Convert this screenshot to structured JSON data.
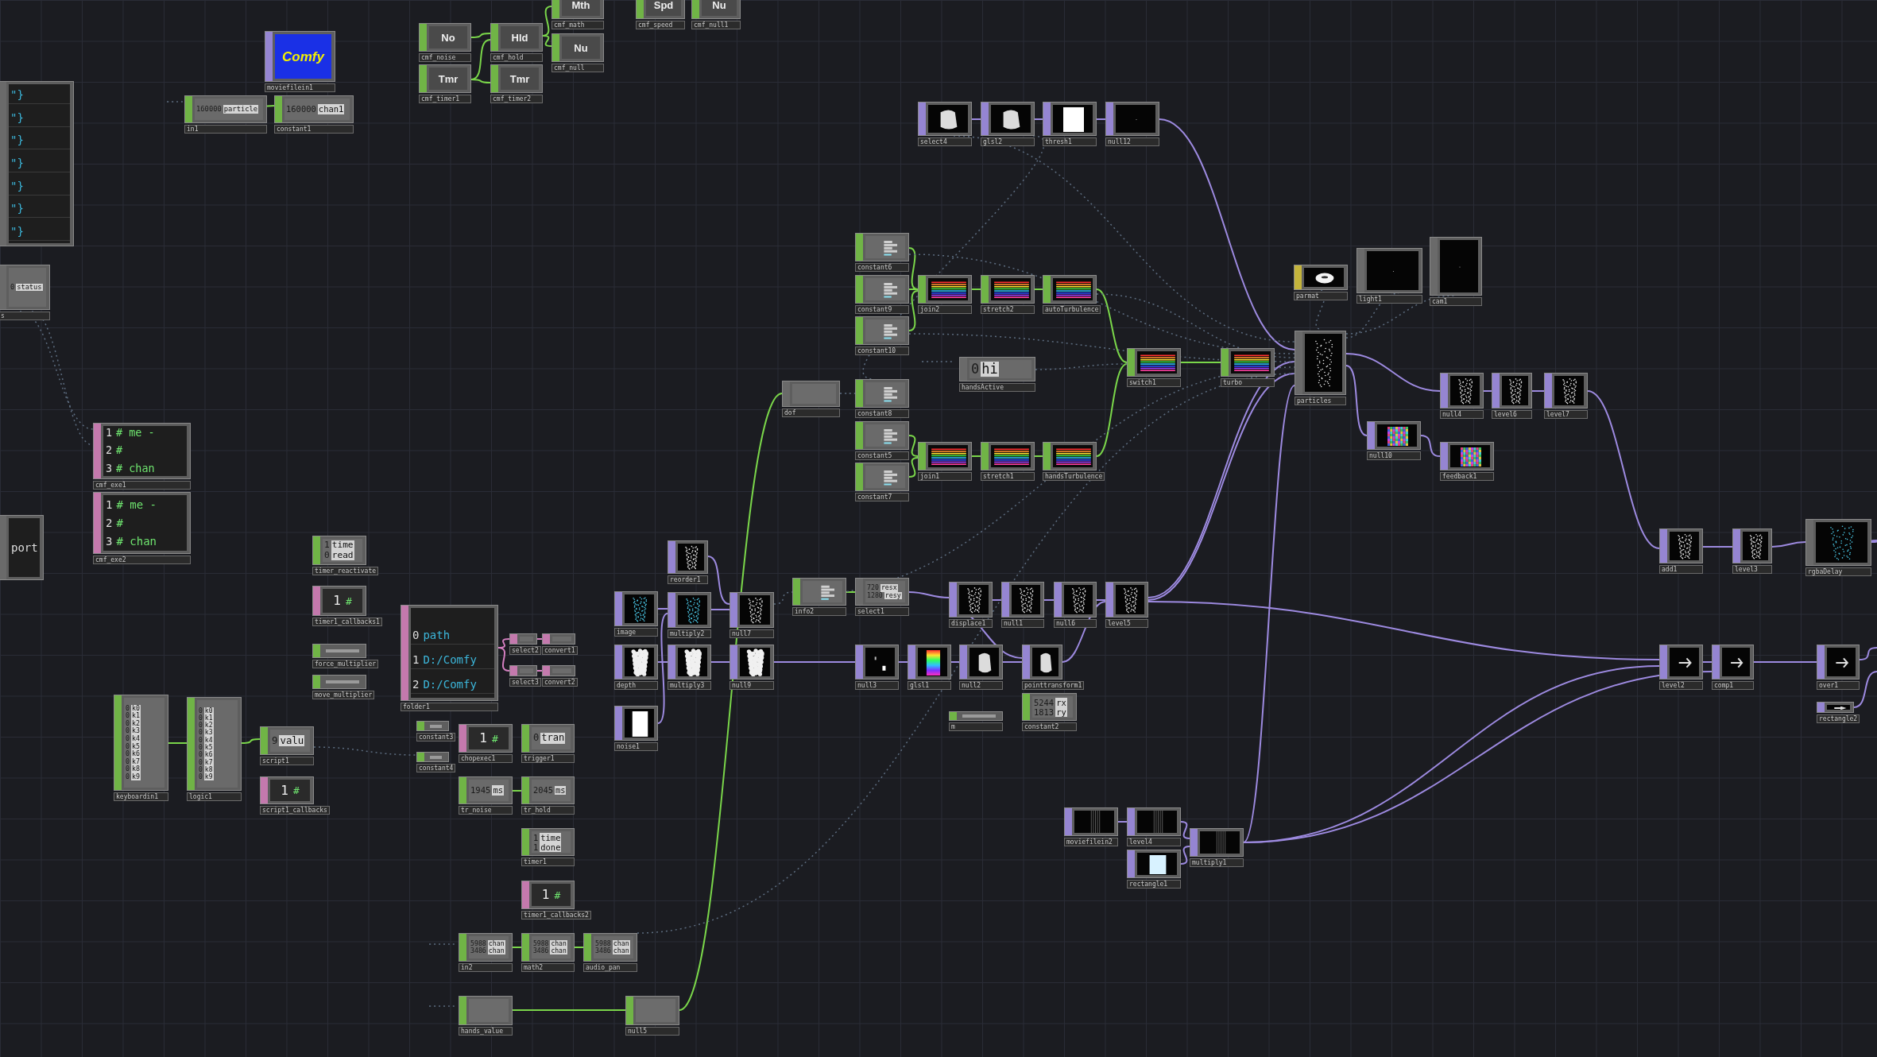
{
  "nodes": [
    {
      "color": "#6a6a6a",
      "kind": "table",
      "rows": [
        [
          "\"}"
        ],
        [
          "\"}"
        ],
        [
          "\"}"
        ],
        [
          "\"}"
        ],
        [
          "\"}"
        ],
        [
          "\"}"
        ],
        [
          "\"}"
        ]
      ]
    },
    {
      "color": "#6a6a6a",
      "label": "s",
      "kind": "rows",
      "rows": [
        [
          "0",
          "status"
        ]
      ]
    },
    {
      "color": "#9585d2",
      "label": "moviefilein1",
      "kind": "logo",
      "text": "Comfy"
    },
    {
      "color": "#70b446",
      "label": "in1",
      "kind": "rows",
      "rows": [
        [
          "160000",
          "particle"
        ]
      ]
    },
    {
      "color": "#70b446",
      "label": "constant1",
      "kind": "rows",
      "rows": [
        [
          "160000",
          "chan1"
        ]
      ]
    },
    {
      "color": "#70b446",
      "label": "cmf_noise",
      "kind": "icon",
      "text": "No"
    },
    {
      "color": "#70b446",
      "label": "cmf_hold",
      "kind": "icon",
      "text": "Hld"
    },
    {
      "color": "#70b446",
      "label": "cmf_timer1",
      "kind": "icon",
      "text": "Tmr"
    },
    {
      "color": "#70b446",
      "label": "cmf_timer2",
      "kind": "icon",
      "text": "Tmr"
    },
    {
      "color": "#70b446",
      "label": "cmf_math",
      "kind": "icon",
      "text": "Mth"
    },
    {
      "color": "#70b446",
      "label": "cmf_null",
      "kind": "icon",
      "text": "Nu"
    },
    {
      "color": "#70b446",
      "label": "cmf_speed",
      "kind": "icon",
      "text": "Spd"
    },
    {
      "color": "#70b446",
      "label": "cmf_null1",
      "kind": "icon",
      "text": "Nu"
    },
    {
      "color": "#c479ad",
      "label": "cmf_exe1",
      "kind": "code",
      "lines": [
        {
          "n": "1",
          "text": "# me -"
        },
        {
          "n": "2",
          "text": "#"
        },
        {
          "n": "3",
          "text": "# chan"
        }
      ]
    },
    {
      "color": "#c479ad",
      "label": "cmf_exe2",
      "kind": "code",
      "lines": [
        {
          "n": "1",
          "text": "# me -"
        },
        {
          "n": "2",
          "text": "#"
        },
        {
          "n": "3",
          "text": "# chan"
        }
      ]
    },
    {
      "color": "#6a6a6a",
      "kind": "code",
      "lines": [
        {
          "text": "port"
        }
      ]
    },
    {
      "color": "#70b446",
      "label": "timer_reactivate",
      "kind": "rows",
      "rows": [
        [
          "1",
          "time"
        ],
        [
          "0",
          "read"
        ]
      ]
    },
    {
      "color": "#c479ad",
      "label": "timer1_callbacks1",
      "kind": "counter",
      "text": "1",
      "mark": "#"
    },
    {
      "color": "#70b446",
      "label": "force_multiplier",
      "kind": "strip"
    },
    {
      "color": "#70b446",
      "label": "move_multiplier",
      "kind": "strip"
    },
    {
      "color": "#c479ad",
      "label": "folder1",
      "kind": "table",
      "rows": [
        [
          "0",
          "path"
        ],
        [
          "1",
          "D:/Comfy"
        ],
        [
          "2",
          "D:/Comfy"
        ]
      ]
    },
    {
      "color": "#c479ad",
      "label": "select2",
      "kind": "blank"
    },
    {
      "color": "#c479ad",
      "label": "convert1",
      "kind": "blank"
    },
    {
      "color": "#c479ad",
      "label": "select3",
      "kind": "blank"
    },
    {
      "color": "#c479ad",
      "label": "convert2",
      "kind": "blank"
    },
    {
      "color": "#70b446",
      "label": "keyboardin1",
      "kind": "rows",
      "rows": [
        [
          "0",
          "k0"
        ],
        [
          "0",
          "k1"
        ],
        [
          "0",
          "k2"
        ],
        [
          "0",
          "k3"
        ],
        [
          "0",
          "k4"
        ],
        [
          "0",
          "k5"
        ],
        [
          "0",
          "k6"
        ],
        [
          "0",
          "k7"
        ],
        [
          "0",
          "k8"
        ],
        [
          "0",
          "k9"
        ]
      ]
    },
    {
      "color": "#70b446",
      "label": "logic1",
      "kind": "rows",
      "rows": [
        [
          "0",
          "k0"
        ],
        [
          "0",
          "k1"
        ],
        [
          "0",
          "k2"
        ],
        [
          "0",
          "k3"
        ],
        [
          "0",
          "k4"
        ],
        [
          "0",
          "k5"
        ],
        [
          "0",
          "k6"
        ],
        [
          "0",
          "k7"
        ],
        [
          "0",
          "k8"
        ],
        [
          "0",
          "k9"
        ]
      ]
    },
    {
      "color": "#70b446",
      "label": "script1",
      "kind": "rows",
      "rows": [
        [
          "9",
          "valu"
        ]
      ]
    },
    {
      "color": "#c479ad",
      "label": "script1_callbacks",
      "kind": "counter",
      "text": "1",
      "mark": "#"
    },
    {
      "color": "#70b446",
      "label": "constant3",
      "kind": "strip"
    },
    {
      "color": "#70b446",
      "label": "constant4",
      "kind": "strip"
    },
    {
      "color": "#c479ad",
      "label": "chopexec1",
      "kind": "counter",
      "text": "1",
      "mark": "#"
    },
    {
      "color": "#70b446",
      "label": "trigger1",
      "kind": "rows",
      "rows": [
        [
          "0",
          "tran"
        ]
      ]
    },
    {
      "color": "#70b446",
      "label": "tr_noise",
      "kind": "rows",
      "rows": [
        [
          "1945",
          "ms"
        ]
      ]
    },
    {
      "color": "#70b446",
      "label": "tr_hold",
      "kind": "rows",
      "rows": [
        [
          "2045",
          "ms"
        ]
      ]
    },
    {
      "color": "#70b446",
      "label": "timer1",
      "kind": "rows",
      "rows": [
        [
          "1",
          "time"
        ],
        [
          "1",
          "done"
        ]
      ]
    },
    {
      "color": "#c479ad",
      "label": "timer1_callbacks2",
      "kind": "counter",
      "text": "1",
      "mark": "#"
    },
    {
      "color": "#70b446",
      "label": "in2",
      "kind": "rows",
      "rows": [
        [
          "5988",
          "chan"
        ],
        [
          "3486",
          "chan"
        ]
      ]
    },
    {
      "color": "#70b446",
      "label": "math2",
      "kind": "rows",
      "rows": [
        [
          "5988",
          "chan"
        ],
        [
          "3486",
          "chan"
        ]
      ]
    },
    {
      "color": "#70b446",
      "label": "audio_pan",
      "kind": "rows",
      "rows": [
        [
          "5988",
          "chan"
        ],
        [
          "3486",
          "chan"
        ]
      ]
    },
    {
      "color": "#70b446",
      "label": "hands_value",
      "kind": "blank"
    },
    {
      "color": "#70b446",
      "label": "null5",
      "kind": "blank"
    },
    {
      "color": "#9585d2",
      "label": "image",
      "kind": "cyan-dots"
    },
    {
      "color": "#9585d2",
      "label": "depth",
      "kind": "figure"
    },
    {
      "color": "#9585d2",
      "label": "noise1",
      "kind": "white"
    },
    {
      "color": "#9585d2",
      "label": "select4",
      "kind": "blob"
    },
    {
      "color": "#9585d2",
      "label": "glsl2",
      "kind": "blob"
    },
    {
      "color": "#9585d2",
      "label": "thresh1",
      "kind": "white"
    },
    {
      "color": "#9585d2",
      "label": "null12",
      "kind": "black"
    },
    {
      "color": "#70b446",
      "label": "constant6",
      "kind": "bars"
    },
    {
      "color": "#70b446",
      "label": "constant9",
      "kind": "bars"
    },
    {
      "color": "#70b446",
      "label": "constant10",
      "kind": "bars"
    },
    {
      "color": "#70b446",
      "label": "constant8",
      "kind": "bars"
    },
    {
      "color": "#70b446",
      "label": "constant5",
      "kind": "bars"
    },
    {
      "color": "#70b446",
      "label": "constant7",
      "kind": "bars"
    },
    {
      "color": "#70b446",
      "label": "join2",
      "kind": "spectrum"
    },
    {
      "color": "#70b446",
      "label": "stretch2",
      "kind": "spectrum"
    },
    {
      "color": "#70b446",
      "label": "autoTurbulence",
      "kind": "spectrum"
    },
    {
      "color": "#70b446",
      "label": "join1",
      "kind": "spectrum"
    },
    {
      "color": "#70b446",
      "label": "stretch1",
      "kind": "spectrum"
    },
    {
      "color": "#70b446",
      "label": "handsTurbulence",
      "kind": "spectrum"
    },
    {
      "color": "#6a6a6a",
      "label": "handsActive",
      "kind": "rows",
      "rows": [
        [
          "0",
          "hi"
        ]
      ]
    },
    {
      "color": "#6a6a6a",
      "label": "dof",
      "kind": "blank"
    },
    {
      "color": "#70b446",
      "label": "switch1",
      "kind": "spectrum"
    },
    {
      "color": "#70b446",
      "label": "turbo",
      "kind": "spectrum"
    },
    {
      "color": "#c4b43c",
      "label": "parmat",
      "kind": "torus"
    },
    {
      "color": "#6a6a6a",
      "label": "light1",
      "kind": "black"
    },
    {
      "color": "#6a6a6a",
      "label": "cam1",
      "kind": "black"
    },
    {
      "color": "#6a6a6a",
      "label": "particles",
      "kind": "dots"
    },
    {
      "color": "#9585d2",
      "label": "null4",
      "kind": "dots"
    },
    {
      "color": "#9585d2",
      "label": "level6",
      "kind": "dots"
    },
    {
      "color": "#9585d2",
      "label": "level7",
      "kind": "dots"
    },
    {
      "color": "#9585d2",
      "label": "null10",
      "kind": "noise"
    },
    {
      "color": "#9585d2",
      "label": "feedback1",
      "kind": "noise"
    },
    {
      "color": "#9585d2",
      "label": "add1",
      "kind": "dots"
    },
    {
      "color": "#9585d2",
      "label": "level3",
      "kind": "dots"
    },
    {
      "color": "#6a6a6a",
      "label": "rgbaDelay",
      "kind": "cyan-dots"
    },
    {
      "color": "#9585d2",
      "label": "reorder1",
      "kind": "dots"
    },
    {
      "color": "#9585d2",
      "label": "multiply2",
      "kind": "cyan-dots"
    },
    {
      "color": "#9585d2",
      "label": "multiply3",
      "kind": "figure"
    },
    {
      "color": "#9585d2",
      "label": "null7",
      "kind": "dots"
    },
    {
      "color": "#9585d2",
      "label": "null9",
      "kind": "figure"
    },
    {
      "color": "#70b446",
      "label": "info2",
      "kind": "bars"
    },
    {
      "color": "#6a6a6a",
      "label": "select1",
      "kind": "rows",
      "rows": [
        [
          "720",
          "resx"
        ],
        [
          "1280",
          "resy"
        ]
      ]
    },
    {
      "color": "#9585d2",
      "label": "displace1",
      "kind": "dots"
    },
    {
      "color": "#9585d2",
      "label": "null1",
      "kind": "dots"
    },
    {
      "color": "#9585d2",
      "label": "null6",
      "kind": "dots"
    },
    {
      "color": "#9585d2",
      "label": "level5",
      "kind": "dots"
    },
    {
      "color": "#9585d2",
      "label": "null3",
      "kind": "points"
    },
    {
      "color": "#9585d2",
      "label": "glsl1",
      "kind": "rainbow"
    },
    {
      "color": "#9585d2",
      "label": "null2",
      "kind": "blob"
    },
    {
      "color": "#9585d2",
      "label": "pointtransform1",
      "kind": "blob"
    },
    {
      "color": "#70b446",
      "label": "m",
      "kind": "strip"
    },
    {
      "color": "#70b446",
      "label": "constant2",
      "kind": "rows",
      "rows": [
        [
          "5244",
          "rx"
        ],
        [
          "1813",
          "ry"
        ]
      ]
    },
    {
      "color": "#9585d2",
      "label": "moviefilein2",
      "kind": "stripes"
    },
    {
      "color": "#9585d2",
      "label": "level4",
      "kind": "stripes"
    },
    {
      "color": "#9585d2",
      "label": "rectangle1",
      "kind": "light-rect"
    },
    {
      "color": "#9585d2",
      "label": "multiply1",
      "kind": "stripes"
    },
    {
      "color": "#9585d2",
      "label": "level2",
      "kind": "arrow"
    },
    {
      "color": "#9585d2",
      "label": "comp1",
      "kind": "arrow"
    },
    {
      "color": "#9585d2",
      "label": "over1",
      "kind": "arrow"
    },
    {
      "color": "#9585d2",
      "label": "rectangle2",
      "kind": "arrow"
    }
  ]
}
